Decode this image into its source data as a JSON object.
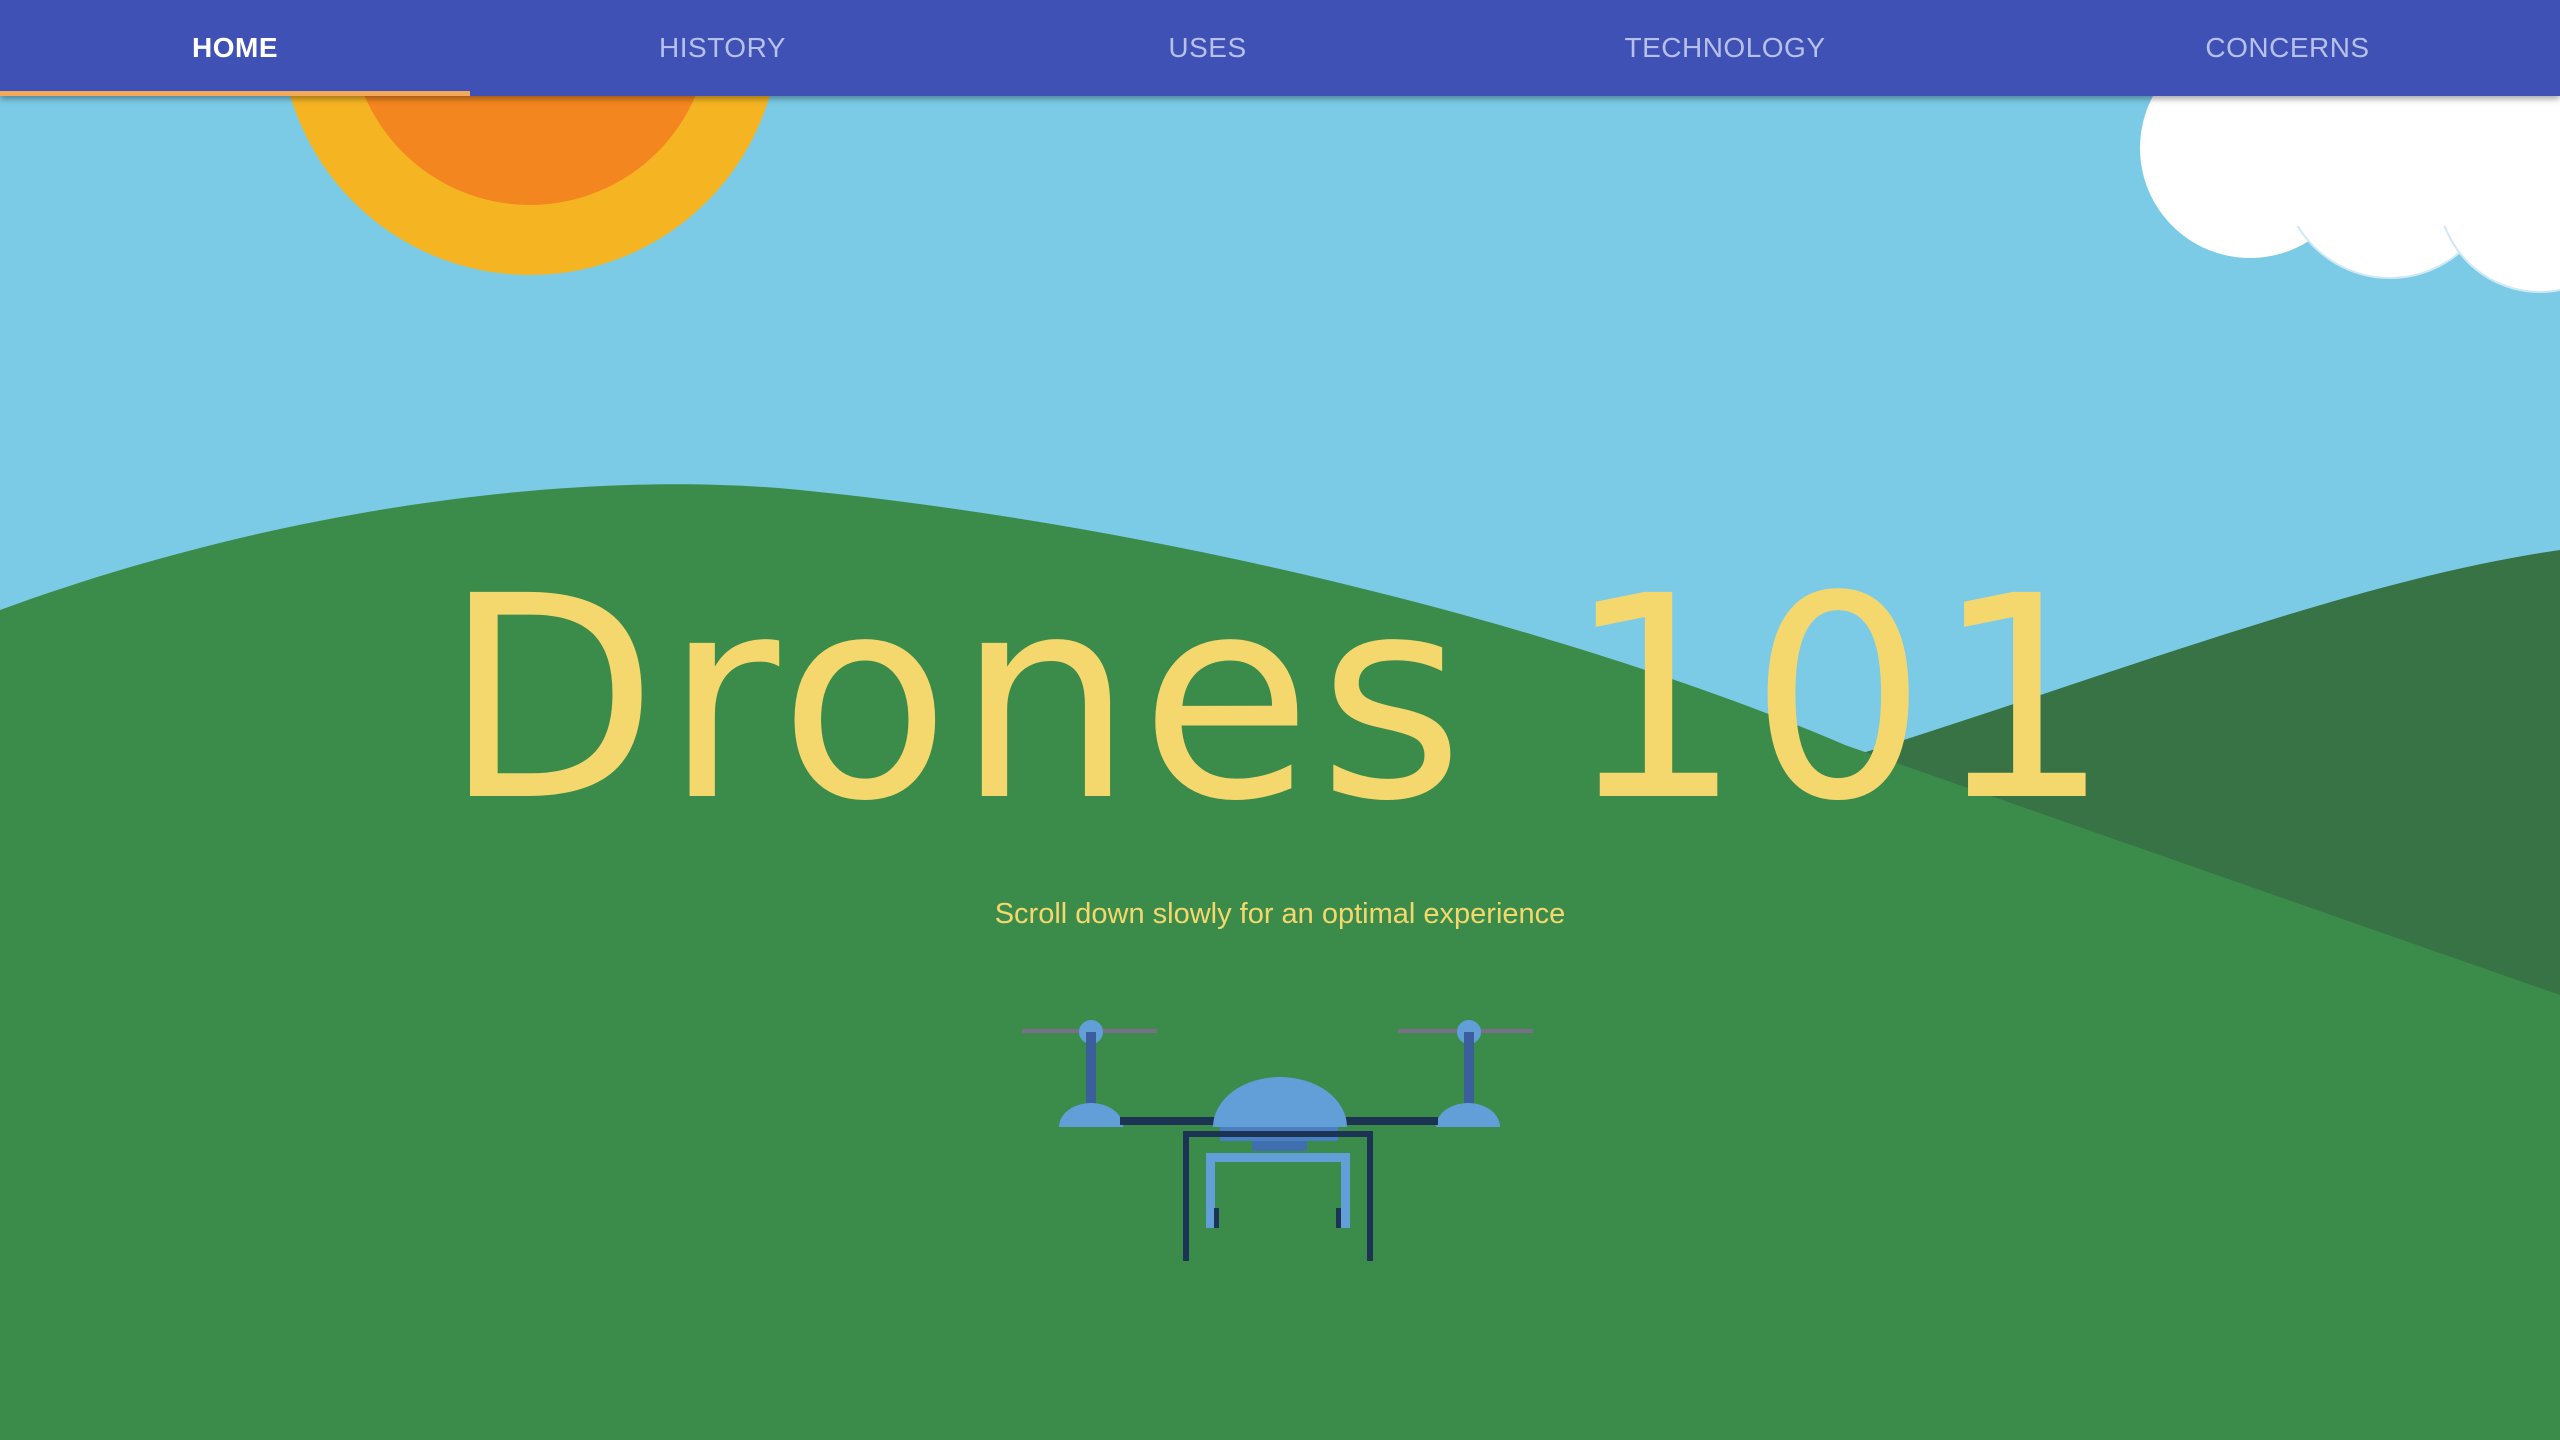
{
  "nav": {
    "tabs": [
      {
        "label": "HOME",
        "active": true
      },
      {
        "label": "HISTORY",
        "active": false
      },
      {
        "label": "USES",
        "active": false
      },
      {
        "label": "TECHNOLOGY",
        "active": false
      },
      {
        "label": "CONCERNS",
        "active": false
      }
    ],
    "indicator_color": "#f2a95a",
    "background_color": "#3f51b5"
  },
  "hero": {
    "title": "Drones 101",
    "subtitle": "Scroll down slowly for an optimal experience",
    "text_color": "#f5d86d"
  },
  "scene": {
    "sky_color": "#7bcbe7",
    "hill_color": "#3b8c4a",
    "back_hill_color": "#377345",
    "sun_outer_color": "#f5b523",
    "sun_inner_color": "#f48620",
    "cloud_color": "#ffffff",
    "drone_body_color": "#629ed8",
    "drone_frame_color": "#1c3353"
  }
}
